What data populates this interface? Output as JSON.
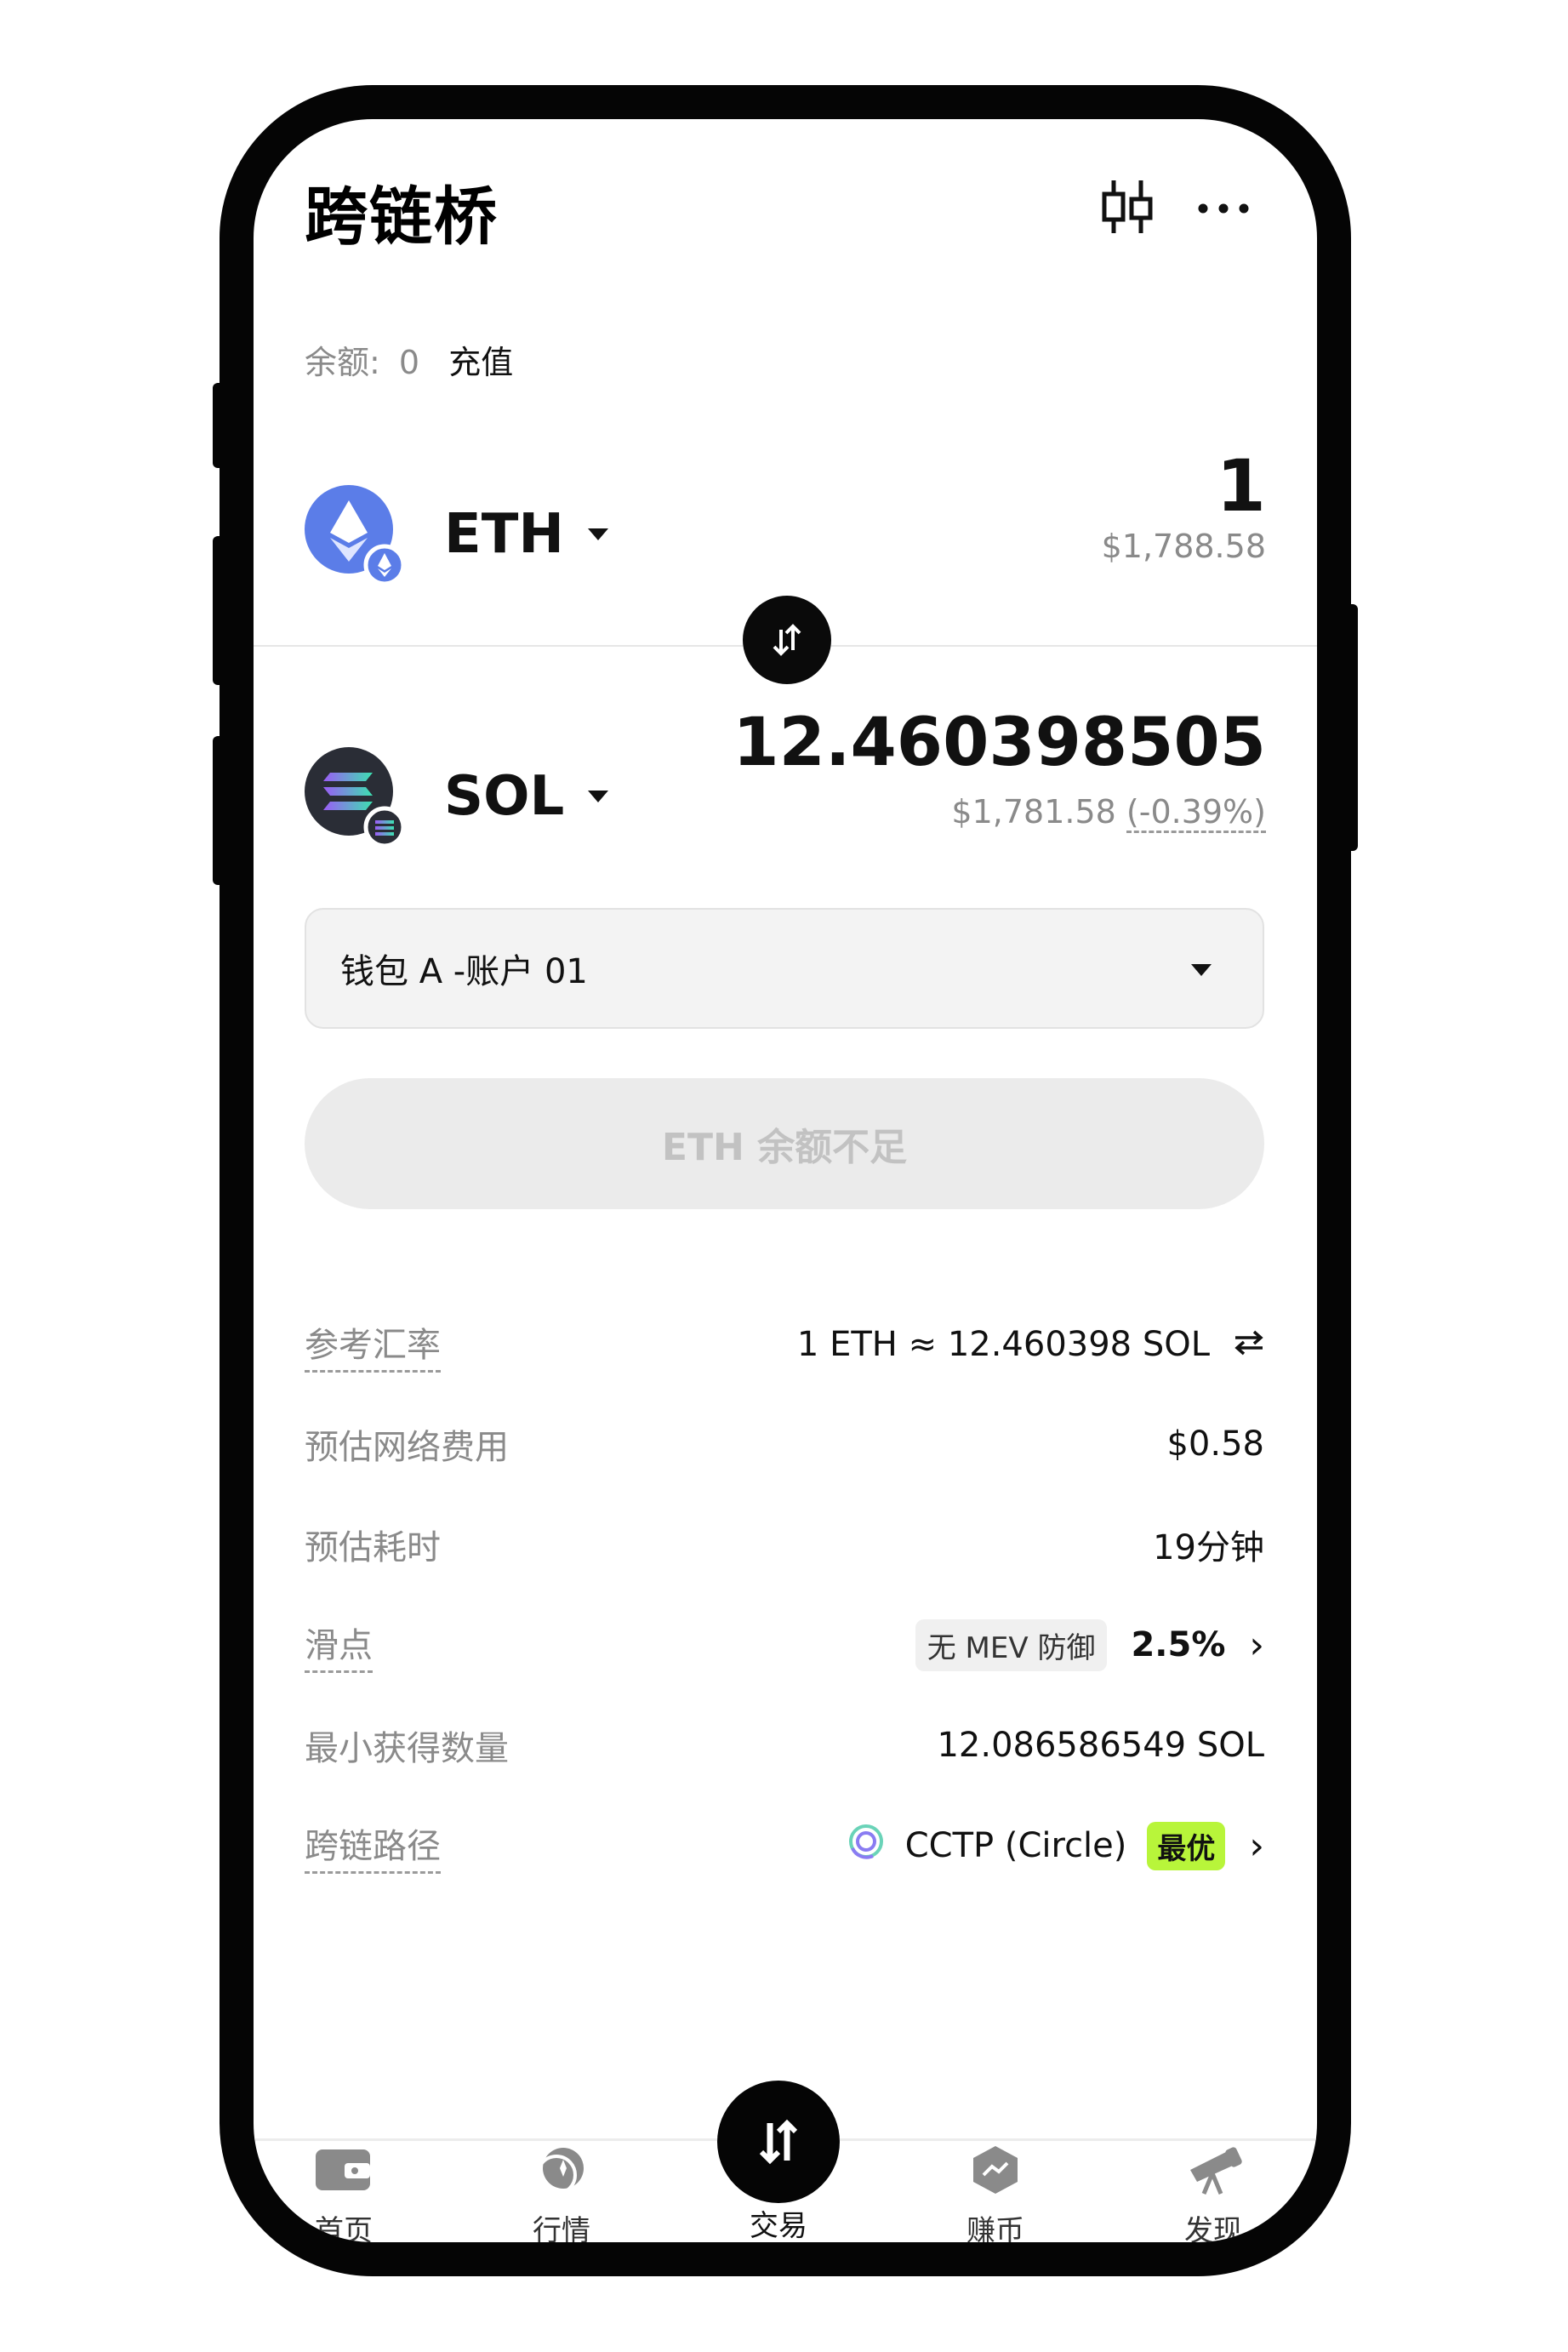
{
  "header": {
    "title": "跨链桥",
    "chart_icon": "candlestick-icon",
    "more_icon": "more-icon"
  },
  "balance": {
    "label": "余额:",
    "value": "0",
    "deposit_link": "充值"
  },
  "from": {
    "token": "ETH",
    "amount": "1",
    "usd": "$1,788.58",
    "icon": "ethereum-icon"
  },
  "to": {
    "token": "SOL",
    "amount": "12.460398505",
    "usd": "$1,781.58",
    "change": "(-0.39%)",
    "icon": "solana-icon"
  },
  "wallet": {
    "selected": "钱包 A -账户 01"
  },
  "cta": {
    "label": "ETH 余额不足"
  },
  "details": {
    "rate": {
      "label": "参考汇率",
      "value": "1 ETH ≈ 12.460398 SOL"
    },
    "fee": {
      "label": "预估网络费用",
      "value": "$0.58"
    },
    "time": {
      "label": "预估耗时",
      "value": "19分钟"
    },
    "slippage": {
      "label": "滑点",
      "mev": "无 MEV 防御",
      "value": "2.5%"
    },
    "min_receive": {
      "label": "最小获得数量",
      "value": "12.086586549 SOL"
    },
    "route": {
      "label": "跨链路径",
      "value": "CCTP (Circle)",
      "badge": "最优"
    }
  },
  "tabs": [
    {
      "label": "首页",
      "icon": "wallet-icon"
    },
    {
      "label": "行情",
      "icon": "market-icon"
    },
    {
      "label": "交易",
      "icon": "trade-icon"
    },
    {
      "label": "赚币",
      "icon": "earn-icon"
    },
    {
      "label": "发现",
      "icon": "telescope-icon"
    }
  ],
  "colors": {
    "accent_green": "#b8f53a",
    "eth_blue": "#5b7de8",
    "dark": "#050505"
  }
}
